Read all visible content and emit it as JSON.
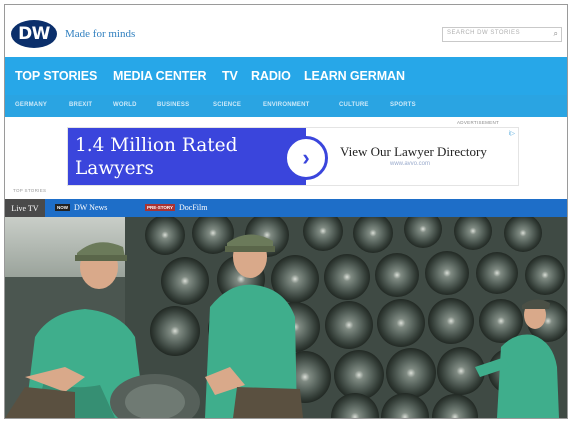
{
  "header": {
    "logo_text": "DW",
    "tagline": "Made for minds",
    "search_placeholder": "SEARCH DW STORIES"
  },
  "main_nav": [
    "TOP STORIES",
    "MEDIA CENTER",
    "TV",
    "RADIO",
    "LEARN GERMAN"
  ],
  "sub_nav": [
    "GERMANY",
    "BREXIT",
    "WORLD",
    "BUSINESS",
    "SCIENCE",
    "ENVIRONMENT",
    "CULTURE",
    "SPORTS"
  ],
  "ad": {
    "label": "ADVERTISEMENT",
    "headline_line1": "1.4 Million Rated",
    "headline_line2": "Lawyers",
    "cta": "View Our Lawyer Directory",
    "url": "www.avvo.com",
    "info": "i▷"
  },
  "section_label": "TOP STORIES",
  "stream_bar": {
    "live_tv": "Live TV",
    "streams": [
      {
        "badge": "NOW",
        "label": "DW News"
      },
      {
        "badge": "PRE-STORY",
        "label": "DocFilm"
      }
    ]
  },
  "colors": {
    "nav": "#27a7e8",
    "stream_bar": "#1e6ec8",
    "ad_blue": "#3a45dc",
    "logo": "#0b2f6b"
  },
  "icons": [
    "search-icon",
    "chevron-right-icon"
  ]
}
